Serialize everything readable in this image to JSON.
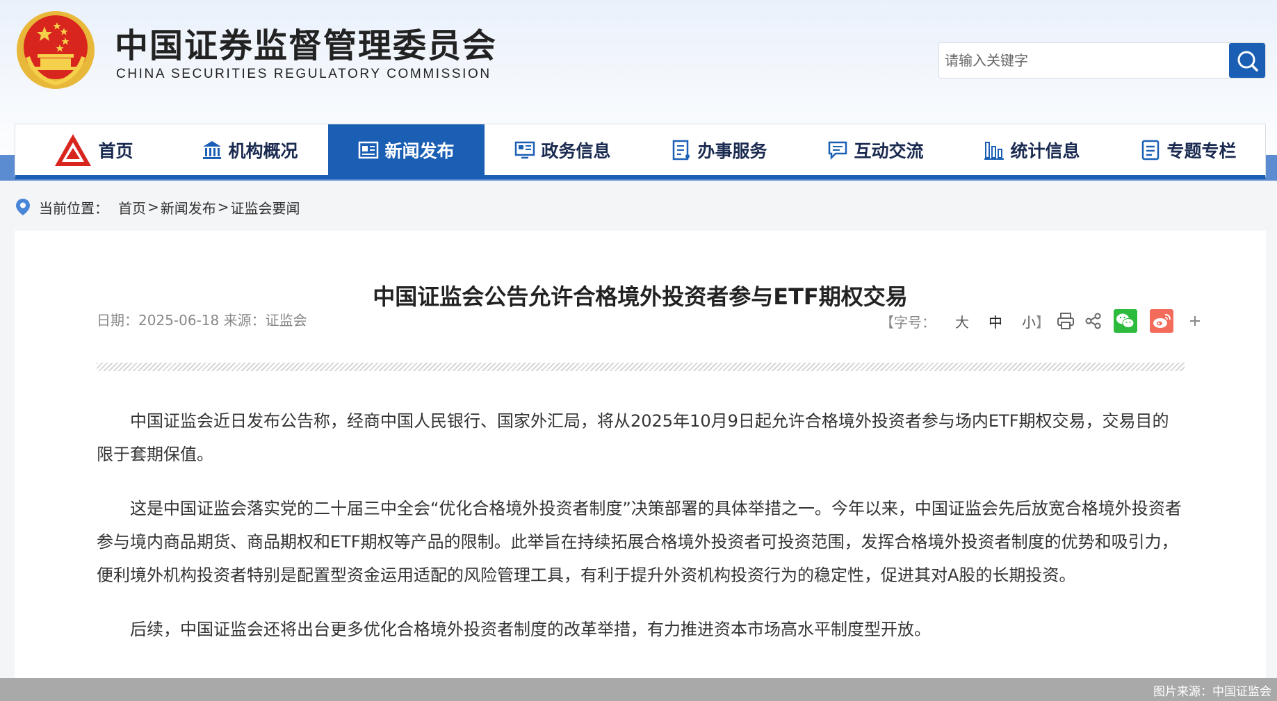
{
  "header": {
    "title_cn": "中国证券监督管理委员会",
    "title_en": "CHINA SECURITIES REGULATORY COMMISSION",
    "search_placeholder": "请输入关键字"
  },
  "nav": {
    "items": [
      {
        "label": "首页",
        "icon": "csrc-logo-icon",
        "active": false
      },
      {
        "label": "机构概况",
        "icon": "building-icon",
        "active": false
      },
      {
        "label": "新闻发布",
        "icon": "newspaper-icon",
        "active": true
      },
      {
        "label": "政务信息",
        "icon": "monitor-icon",
        "active": false
      },
      {
        "label": "办事服务",
        "icon": "document-icon",
        "active": false
      },
      {
        "label": "互动交流",
        "icon": "chat-icon",
        "active": false
      },
      {
        "label": "统计信息",
        "icon": "bar-chart-icon",
        "active": false
      },
      {
        "label": "专题专栏",
        "icon": "list-icon",
        "active": false
      }
    ],
    "active_color": "#1b5fb5"
  },
  "breadcrumb": {
    "prefix": "当前位置：",
    "items": [
      "首页",
      "新闻发布",
      "证监会要闻"
    ],
    "separator": ">"
  },
  "article": {
    "title": "中国证监会公告允许合格境外投资者参与ETF期权交易",
    "meta": "日期：2025-06-18 来源：证监会",
    "font_size_label": "【字号：",
    "font_sizes": [
      "大",
      "中",
      "小"
    ],
    "font_size_close": "】",
    "paragraphs": [
      "中国证监会近日发布公告称，经商中国人民银行、国家外汇局，将从2025年10月9日起允许合格境外投资者参与场内ETF期权交易，交易目的限于套期保值。",
      "这是中国证监会落实党的二十届三中全会“优化合格境外投资者制度”决策部署的具体举措之一。今年以来，中国证监会先后放宽合格境外投资者参与境内商品期货、商品期权和ETF期权等产品的限制。此举旨在持续拓展合格境外投资者可投资范围，发挥合格境外投资者制度的优势和吸引力，便利境外机构投资者特别是配置型资金运用适配的风险管理工具，有利于提升外资机构投资行为的稳定性，促进其对A股的长期投资。",
      "后续，中国证监会还将出台更多优化合格境外投资者制度的改革举措，有力推进资本市场高水平制度型开放。"
    ]
  },
  "footer": {
    "credit": "图片来源：中国证监会"
  },
  "colors": {
    "brand_blue": "#1b5fb5",
    "wechat_green": "#2dbb3e",
    "weibo_red": "#f26b5b"
  }
}
